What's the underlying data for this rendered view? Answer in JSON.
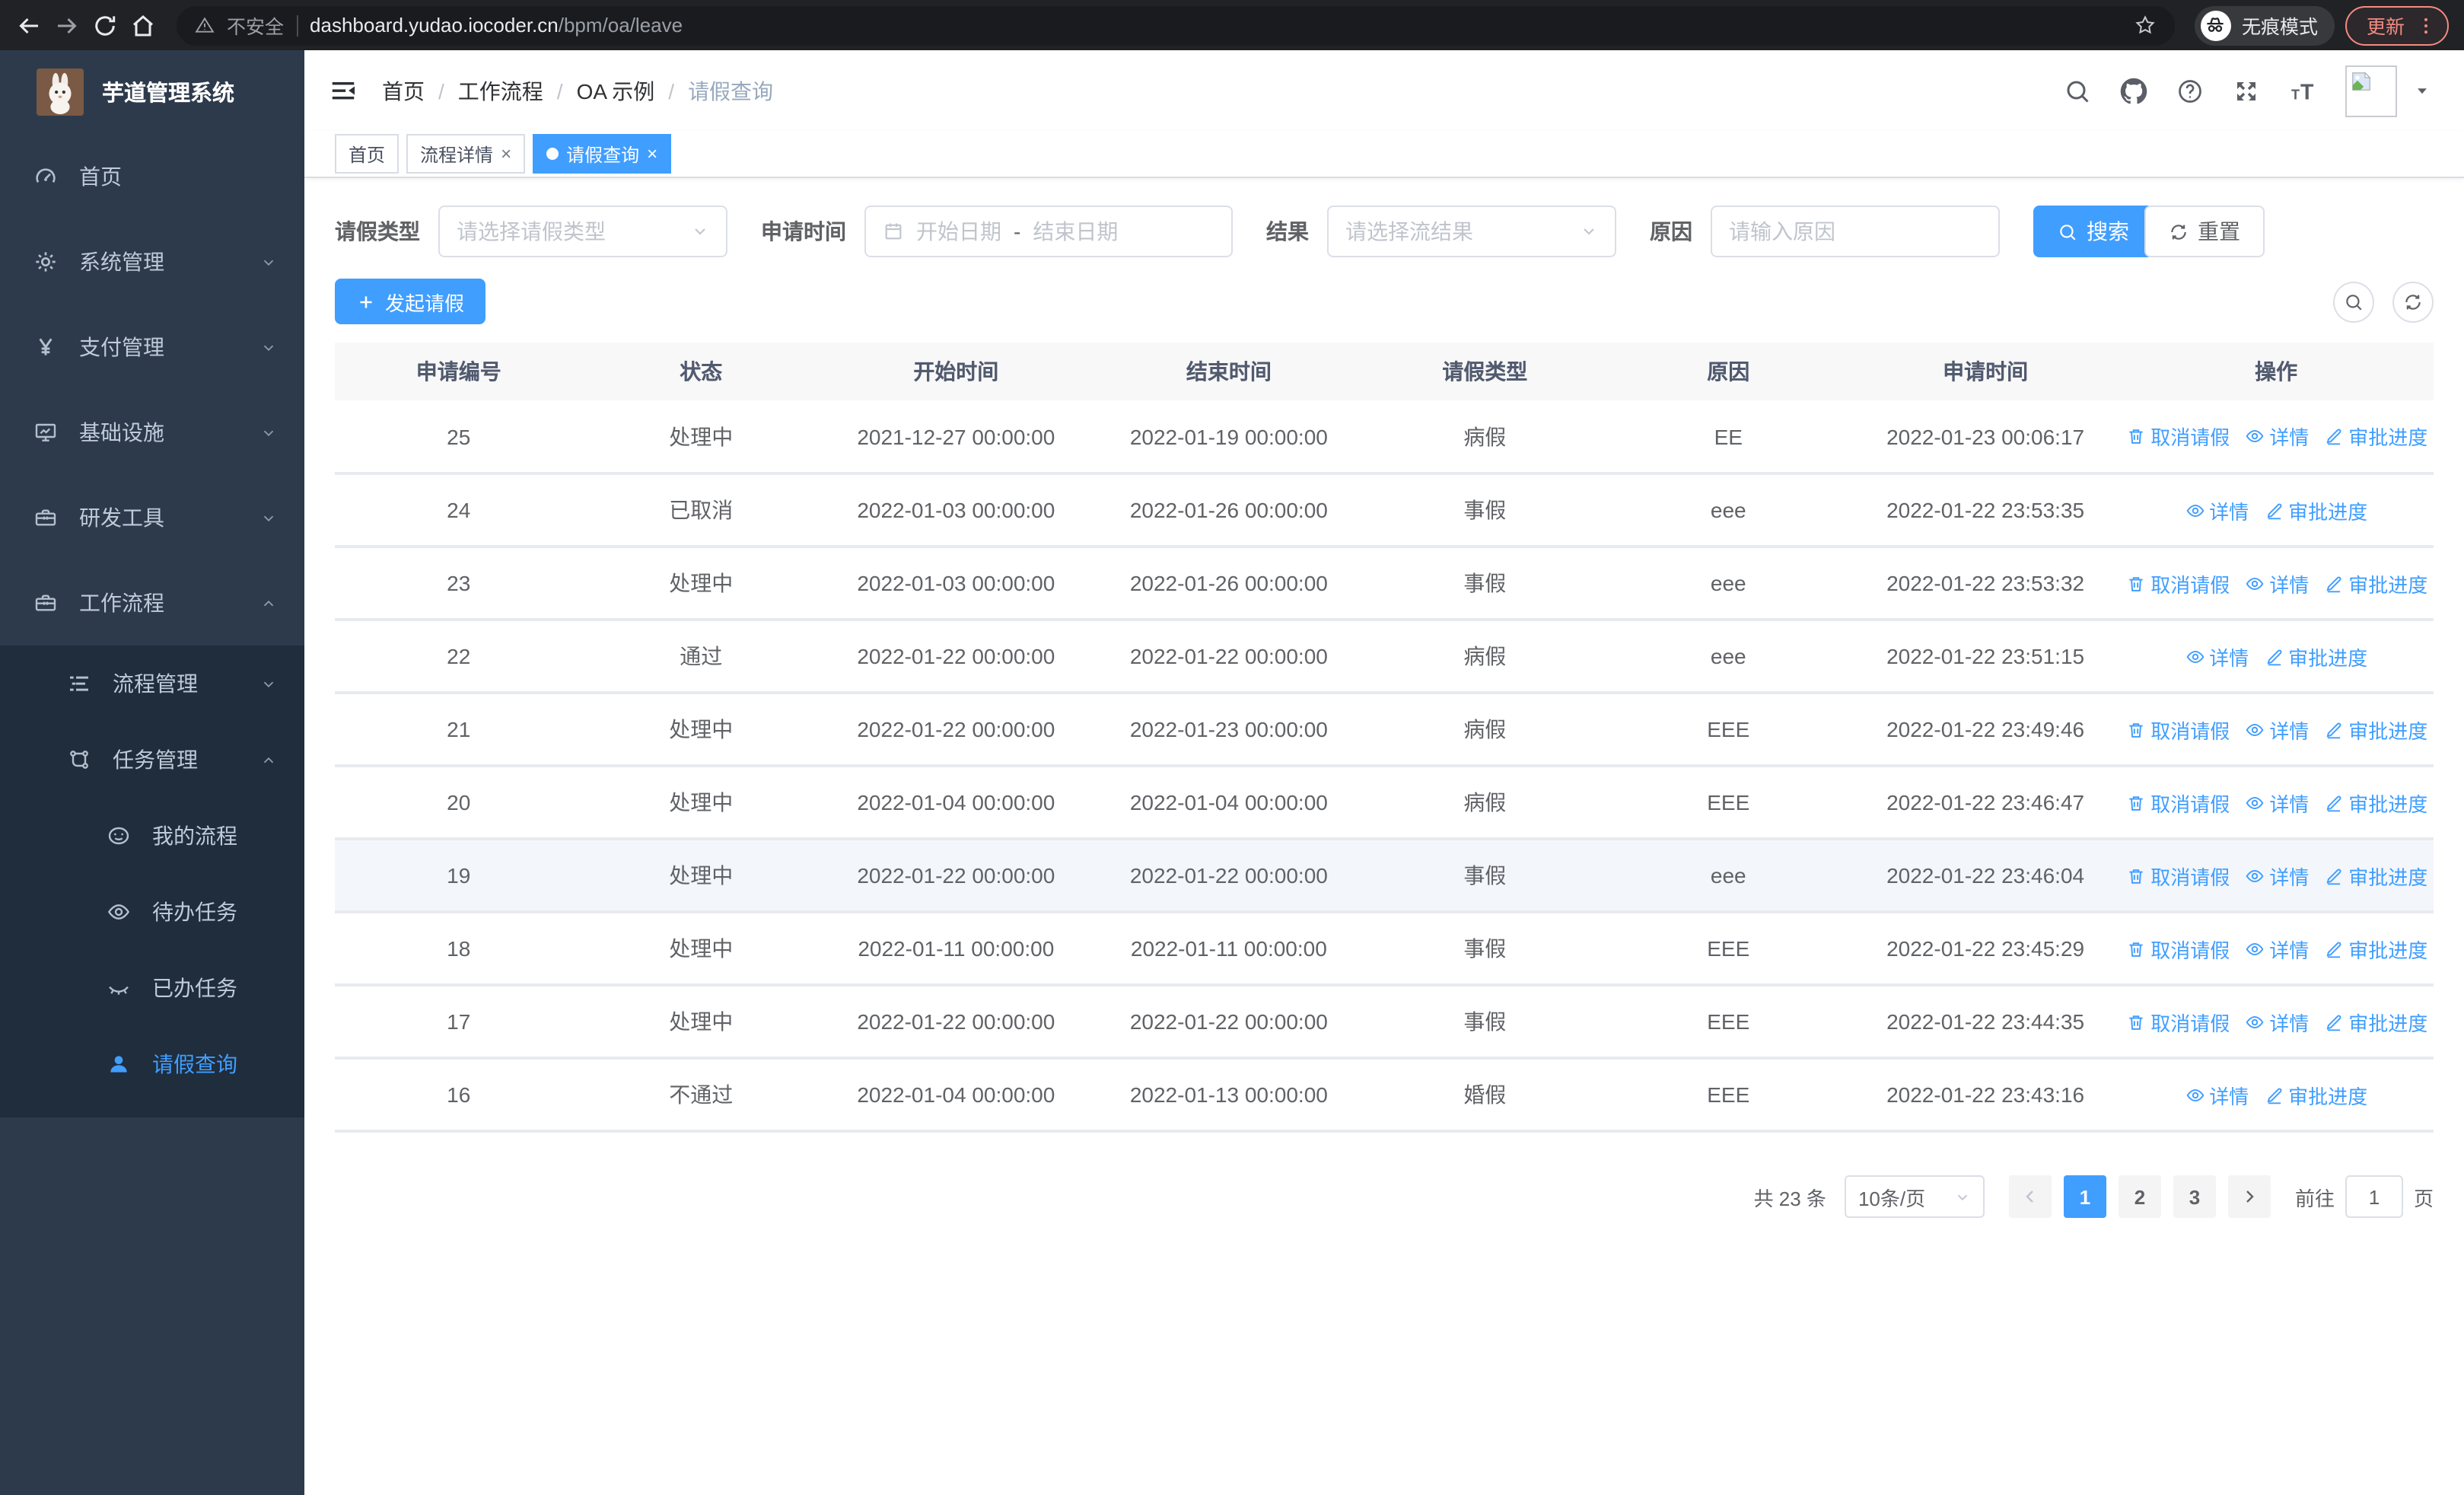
{
  "browser": {
    "security_label": "不安全",
    "url_host": "dashboard.yudao.iocoder.cn",
    "url_path": "/bpm/oa/leave",
    "incognito_label": "无痕模式",
    "update_label": "更新"
  },
  "sidebar": {
    "title": "芋道管理系统",
    "menu": [
      {
        "key": "home",
        "label": "首页",
        "icon": "dashboard-icon",
        "level": 1
      },
      {
        "key": "system-mgmt",
        "label": "系统管理",
        "icon": "gear-icon",
        "level": 1,
        "chevron": "down"
      },
      {
        "key": "payment-mgmt",
        "label": "支付管理",
        "icon": "yen-icon",
        "level": 1,
        "chevron": "down"
      },
      {
        "key": "infrastructure",
        "label": "基础设施",
        "icon": "monitor-icon",
        "level": 1,
        "chevron": "down"
      },
      {
        "key": "dev-tools",
        "label": "研发工具",
        "icon": "toolbox-icon",
        "level": 1,
        "chevron": "down"
      },
      {
        "key": "workflow",
        "label": "工作流程",
        "icon": "briefcase-icon",
        "level": 1,
        "chevron": "up"
      },
      {
        "key": "process-mgmt",
        "label": "流程管理",
        "icon": "list-tree-icon",
        "level": 2,
        "chevron": "down",
        "submenu": true
      },
      {
        "key": "task-mgmt",
        "label": "任务管理",
        "icon": "workflow-icon",
        "level": 2,
        "chevron": "up",
        "submenu": true
      },
      {
        "key": "my-process",
        "label": "我的流程",
        "icon": "robot-icon",
        "level": 3,
        "submenu": true
      },
      {
        "key": "todo-tasks",
        "label": "待办任务",
        "icon": "eye-icon",
        "level": 3,
        "submenu": true
      },
      {
        "key": "done-tasks",
        "label": "已办任务",
        "icon": "eye-closed-icon",
        "level": 3,
        "submenu": true
      },
      {
        "key": "leave-query",
        "label": "请假查询",
        "icon": "user-icon",
        "level": 3,
        "submenu": true,
        "active": true
      }
    ]
  },
  "header": {
    "breadcrumb": [
      "首页",
      "工作流程",
      "OA 示例",
      "请假查询"
    ]
  },
  "tabs": [
    {
      "key": "home",
      "label": "首页",
      "active": false,
      "closable": false
    },
    {
      "key": "process-detail",
      "label": "流程详情",
      "active": false,
      "closable": true
    },
    {
      "key": "leave-query",
      "label": "请假查询",
      "active": true,
      "closable": true
    }
  ],
  "filters": {
    "leave_type_label": "请假类型",
    "leave_type_placeholder": "请选择请假类型",
    "apply_time_label": "申请时间",
    "start_date_placeholder": "开始日期",
    "date_separator": "-",
    "end_date_placeholder": "结束日期",
    "result_label": "结果",
    "result_placeholder": "请选择流结果",
    "reason_label": "原因",
    "reason_placeholder": "请输入原因",
    "search_label": "搜索",
    "reset_label": "重置"
  },
  "toolbar": {
    "create_label": "发起请假"
  },
  "table": {
    "columns": [
      "申请编号",
      "状态",
      "开始时间",
      "结束时间",
      "请假类型",
      "原因",
      "申请时间",
      "操作"
    ],
    "action_labels": {
      "cancel": "取消请假",
      "detail": "详情",
      "progress": "审批进度"
    },
    "rows": [
      {
        "id": "25",
        "status": "处理中",
        "start": "2021-12-27 00:00:00",
        "end": "2022-01-19 00:00:00",
        "type": "病假",
        "reason": "EE",
        "applied": "2022-01-23 00:06:17",
        "actions": [
          "cancel",
          "detail",
          "progress"
        ],
        "highlight": false
      },
      {
        "id": "24",
        "status": "已取消",
        "start": "2022-01-03 00:00:00",
        "end": "2022-01-26 00:00:00",
        "type": "事假",
        "reason": "eee",
        "applied": "2022-01-22 23:53:35",
        "actions": [
          "detail",
          "progress"
        ],
        "highlight": false
      },
      {
        "id": "23",
        "status": "处理中",
        "start": "2022-01-03 00:00:00",
        "end": "2022-01-26 00:00:00",
        "type": "事假",
        "reason": "eee",
        "applied": "2022-01-22 23:53:32",
        "actions": [
          "cancel",
          "detail",
          "progress"
        ],
        "highlight": false
      },
      {
        "id": "22",
        "status": "通过",
        "start": "2022-01-22 00:00:00",
        "end": "2022-01-22 00:00:00",
        "type": "病假",
        "reason": "eee",
        "applied": "2022-01-22 23:51:15",
        "actions": [
          "detail",
          "progress"
        ],
        "highlight": false
      },
      {
        "id": "21",
        "status": "处理中",
        "start": "2022-01-22 00:00:00",
        "end": "2022-01-23 00:00:00",
        "type": "病假",
        "reason": "EEE",
        "applied": "2022-01-22 23:49:46",
        "actions": [
          "cancel",
          "detail",
          "progress"
        ],
        "highlight": false
      },
      {
        "id": "20",
        "status": "处理中",
        "start": "2022-01-04 00:00:00",
        "end": "2022-01-04 00:00:00",
        "type": "病假",
        "reason": "EEE",
        "applied": "2022-01-22 23:46:47",
        "actions": [
          "cancel",
          "detail",
          "progress"
        ],
        "highlight": false
      },
      {
        "id": "19",
        "status": "处理中",
        "start": "2022-01-22 00:00:00",
        "end": "2022-01-22 00:00:00",
        "type": "事假",
        "reason": "eee",
        "applied": "2022-01-22 23:46:04",
        "actions": [
          "cancel",
          "detail",
          "progress"
        ],
        "highlight": true
      },
      {
        "id": "18",
        "status": "处理中",
        "start": "2022-01-11 00:00:00",
        "end": "2022-01-11 00:00:00",
        "type": "事假",
        "reason": "EEE",
        "applied": "2022-01-22 23:45:29",
        "actions": [
          "cancel",
          "detail",
          "progress"
        ],
        "highlight": false
      },
      {
        "id": "17",
        "status": "处理中",
        "start": "2022-01-22 00:00:00",
        "end": "2022-01-22 00:00:00",
        "type": "事假",
        "reason": "EEE",
        "applied": "2022-01-22 23:44:35",
        "actions": [
          "cancel",
          "detail",
          "progress"
        ],
        "highlight": false
      },
      {
        "id": "16",
        "status": "不通过",
        "start": "2022-01-04 00:00:00",
        "end": "2022-01-13 00:00:00",
        "type": "婚假",
        "reason": "EEE",
        "applied": "2022-01-22 23:43:16",
        "actions": [
          "detail",
          "progress"
        ],
        "highlight": false
      }
    ]
  },
  "pagination": {
    "total_label": "共 23 条",
    "page_size": "10条/页",
    "pages": [
      "1",
      "2",
      "3"
    ],
    "active_page": "1",
    "goto_label": "前往",
    "goto_value": "1",
    "page_suffix": "页"
  },
  "colors": {
    "primary": "#409EFF",
    "sidebar_bg": "#2d3a4b",
    "submenu_bg": "#1f2d3d",
    "update_red": "#f28b82"
  }
}
